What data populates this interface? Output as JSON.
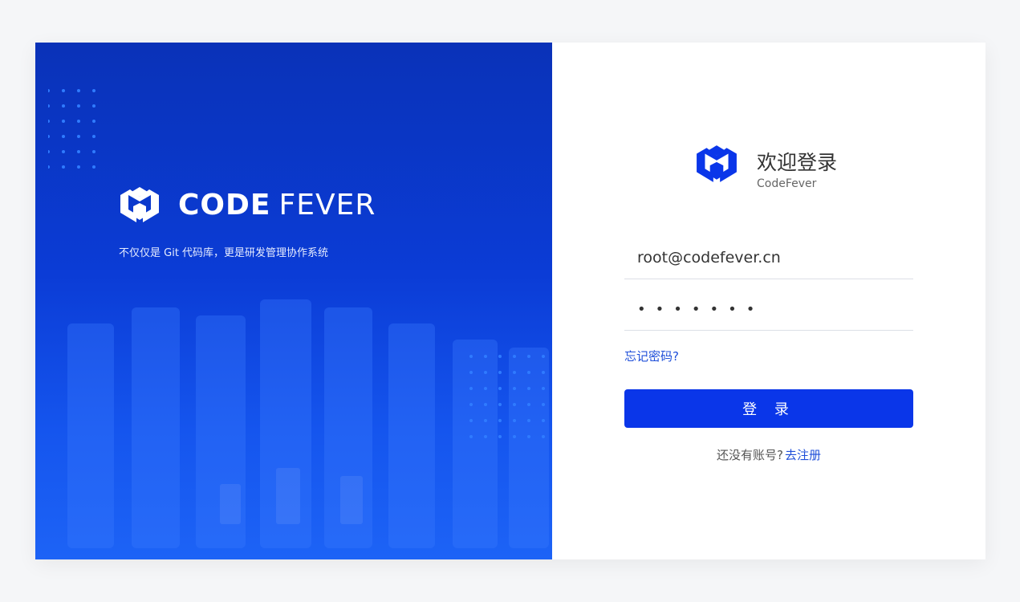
{
  "brand": {
    "name_bold": "CODE",
    "name_light": "FEVER",
    "tagline": "不仅仅是 Git 代码库，更是研发管理协作系统"
  },
  "login": {
    "welcome": "欢迎登录",
    "product": "CodeFever",
    "email_value": "root@codefever.cn",
    "password_mask": "•••••••",
    "forgot_label": "忘记密码?",
    "submit_label": "登 录",
    "signup_prompt": "还没有账号?",
    "signup_link": "去注册"
  },
  "icons": {
    "logo": "codefever-logo-icon"
  },
  "colors": {
    "brand_blue": "#0a36e9",
    "panel_blue": "#0b3cd6",
    "link_blue": "#1f4fd9"
  }
}
